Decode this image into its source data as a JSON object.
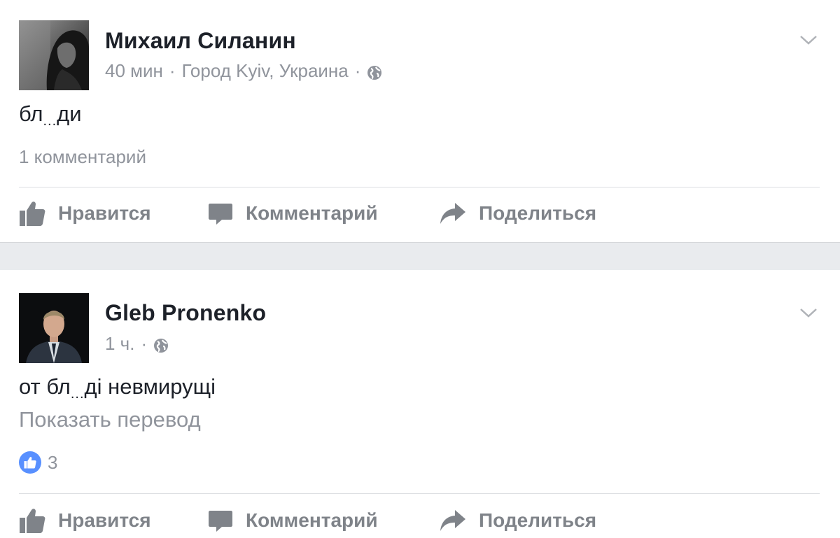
{
  "posts": [
    {
      "author": "Михаил Силанин",
      "time": "40 мин",
      "location": "Город Kyiv, Украина",
      "text_before": "бл",
      "text_ellipsis": "...",
      "text_after": "ди",
      "comments_count": "1 комментарий"
    },
    {
      "author": "Gleb Pronenko",
      "time": "1 ч.",
      "text_before": "от бл",
      "text_ellipsis": "...",
      "text_after": "ді невмирущі",
      "translate": "Показать перевод",
      "likes": "3"
    }
  ],
  "actions": {
    "like": "Нравится",
    "comment": "Комментарий",
    "share": "Поделиться"
  },
  "colors": {
    "meta": "#90949c",
    "action": "#7f8389",
    "like_badge": "#5890ff",
    "separator": "#e9ebee"
  },
  "icons": [
    "globe-icon",
    "chevron-down-icon",
    "thumbs-up-icon",
    "comment-bubble-icon",
    "share-arrow-icon"
  ]
}
